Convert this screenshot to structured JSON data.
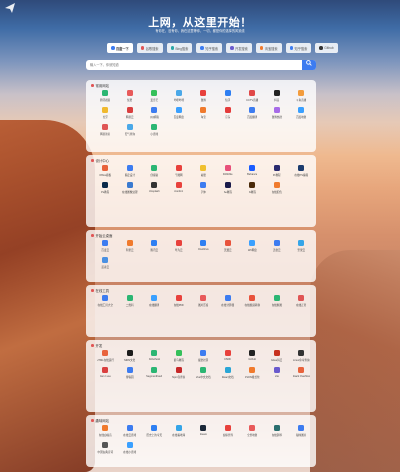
{
  "header": {
    "logo_icon": "paper-plane-icon",
    "title": "上网，从这里开始！",
    "subtitle": "有你在，没有你，我在这里等你，一切，都是你的选择的风景线"
  },
  "search": {
    "engines": [
      {
        "label": "百度一下",
        "color": "#3d7cf0"
      },
      {
        "label": "谷歌搜索",
        "color": "#e05555"
      },
      {
        "label": "Bing搜索",
        "color": "#2aa6a6"
      },
      {
        "label": "知乎搜索",
        "color": "#3d7cf0"
      },
      {
        "label": "开发搜索",
        "color": "#6a5acd"
      },
      {
        "label": "淘宝搜索",
        "color": "#f07a2d"
      },
      {
        "label": "知乎搜索",
        "color": "#3d7cf0"
      },
      {
        "label": "Github",
        "color": "#333333"
      }
    ],
    "placeholder": "输入一下，你就知道",
    "submit_icon": "search-icon"
  },
  "sections": [
    {
      "title": "常用网站",
      "items": [
        {
          "label": "腾讯视频",
          "color": "#2bb673"
        },
        {
          "label": "优酷",
          "color": "#e85a5a"
        },
        {
          "label": "爱奇艺",
          "color": "#35c05a"
        },
        {
          "label": "哔哩哔哩",
          "color": "#4aa8e8"
        },
        {
          "label": "微博",
          "color": "#e8413c"
        },
        {
          "label": "知乎",
          "color": "#2e7ff2"
        },
        {
          "label": "CCTV直播",
          "color": "#e04848"
        },
        {
          "label": "抖音",
          "color": "#222222"
        },
        {
          "label": "斗鱼直播",
          "color": "#f39c3c"
        },
        {
          "label": "虎牙",
          "color": "#f0b92f"
        },
        {
          "label": "网易云",
          "color": "#d93f3f"
        },
        {
          "label": "QQ邮箱",
          "color": "#3d7cf0"
        },
        {
          "label": "百度网盘",
          "color": "#3aa0ff"
        },
        {
          "label": "淘宝",
          "color": "#f07a2d"
        },
        {
          "label": "京东",
          "color": "#e43c3c"
        },
        {
          "label": "百度翻译",
          "color": "#3d7cf0"
        },
        {
          "label": "微博热搜",
          "color": "#a76be8"
        },
        {
          "label": "百度地图",
          "color": "#3aa0ff"
        },
        {
          "label": "网易新闻",
          "color": "#e05555"
        },
        {
          "label": "天气查询",
          "color": "#4aa8e8"
        },
        {
          "label": "小游戏",
          "color": "#2bb673"
        }
      ]
    },
    {
      "title": "设计中心",
      "items": [
        {
          "label": "Office模板",
          "color": "#e8633c"
        },
        {
          "label": "稿定设计",
          "color": "#3d7cf0"
        },
        {
          "label": "创客贴",
          "color": "#2bb673"
        },
        {
          "label": "千图网",
          "color": "#e8413c"
        },
        {
          "label": "站酷",
          "color": "#f0c02f"
        },
        {
          "label": "Dribbble",
          "color": "#e8507a"
        },
        {
          "label": "Behance",
          "color": "#1a5cff"
        },
        {
          "label": "Pr教程",
          "color": "#2a2a6e"
        },
        {
          "label": "在线PS编辑",
          "color": "#1c3c6e"
        },
        {
          "label": "Ps教程",
          "color": "#0a2a4a"
        },
        {
          "label": "在线图像处理",
          "color": "#3a7ad0"
        },
        {
          "label": "Unsplash",
          "color": "#333333"
        },
        {
          "label": "iconfont",
          "color": "#e8413c"
        },
        {
          "label": "字体",
          "color": "#3d7cf0"
        },
        {
          "label": "Ae教程",
          "color": "#1a1a4a"
        },
        {
          "label": "Ai教程",
          "color": "#4a2a0a"
        },
        {
          "label": "在线配色",
          "color": "#f07a2d"
        }
      ]
    },
    {
      "title": "开始云桌面",
      "items": [
        {
          "label": "百度云",
          "color": "#3d7cf0"
        },
        {
          "label": "阿里云",
          "color": "#f07a2d"
        },
        {
          "label": "腾讯云",
          "color": "#2e7ff2"
        },
        {
          "label": "华为云",
          "color": "#e8413c"
        },
        {
          "label": "OneDrive",
          "color": "#2e7ff2"
        },
        {
          "label": "天翼云",
          "color": "#e8533c"
        },
        {
          "label": "115网盘",
          "color": "#3aa0ff"
        },
        {
          "label": "迅雷云",
          "color": "#3d7cf0"
        },
        {
          "label": "坚果云",
          "color": "#35a5e8"
        },
        {
          "label": "蓝奏云",
          "color": "#4a90e2"
        }
      ]
    },
    {
      "title": "在线工具",
      "items": [
        {
          "label": "在线工具大全",
          "color": "#3d7cf0"
        },
        {
          "label": "二维码",
          "color": "#2bb673"
        },
        {
          "label": "在线翻译",
          "color": "#3aa0ff"
        },
        {
          "label": "在线PDF",
          "color": "#e8413c"
        },
        {
          "label": "图片压缩",
          "color": "#e85a5a"
        },
        {
          "label": "在线计算器",
          "color": "#3d7cf0"
        },
        {
          "label": "在线视频转换",
          "color": "#e8533c"
        },
        {
          "label": "在线抠图",
          "color": "#2bb673"
        },
        {
          "label": "在线正则",
          "color": "#e05555"
        }
      ]
    },
    {
      "title": "开发",
      "items": [
        {
          "label": "HTML在线运行",
          "color": "#e8633c"
        },
        {
          "label": "MDN文档",
          "color": "#1c1c1c"
        },
        {
          "label": "W3school",
          "color": "#2bb673"
        },
        {
          "label": "菜鸟教程",
          "color": "#35c05a"
        },
        {
          "label": "掘金社区",
          "color": "#3d7cf0"
        },
        {
          "label": "CSDN",
          "color": "#e8413c"
        },
        {
          "label": "Github",
          "color": "#222222"
        },
        {
          "label": "Gitee码云",
          "color": "#c7311e"
        },
        {
          "label": "Linux命令查询",
          "color": "#333333"
        },
        {
          "label": "Can I use",
          "color": "#d93f3f"
        },
        {
          "label": "博客园",
          "color": "#3d7cf0"
        },
        {
          "label": "SegmentFault",
          "color": "#2bb673"
        },
        {
          "label": "Npm包查询",
          "color": "#c62828"
        },
        {
          "label": "Vue中文文档",
          "color": "#2bb673"
        },
        {
          "label": "React文档",
          "color": "#2aa6d6"
        },
        {
          "label": "JSON格式化",
          "color": "#f07a2d"
        },
        {
          "label": "Vite",
          "color": "#6a5acd"
        },
        {
          "label": "Stack Overflow",
          "color": "#e8633c"
        }
      ]
    },
    {
      "title": "趣味网站",
      "items": [
        {
          "label": "在线白噪音",
          "color": "#f07a2d"
        },
        {
          "label": "在线云游戏",
          "color": "#3d7cf0"
        },
        {
          "label": "历史上的今天",
          "color": "#2e7ff2"
        },
        {
          "label": "在线看地球",
          "color": "#35a5e8"
        },
        {
          "label": "Steam",
          "color": "#1b2838"
        },
        {
          "label": "虚拟世界",
          "color": "#e8413c"
        },
        {
          "label": "全景地图",
          "color": "#e85a5a"
        },
        {
          "label": "在线钢琴",
          "color": "#2a6e6e"
        },
        {
          "label": "猫咪图片",
          "color": "#3d7cf0"
        },
        {
          "label": "中国古典诗词",
          "color": "#555555"
        },
        {
          "label": "在线小游戏",
          "color": "#3aa0ff"
        }
      ]
    }
  ]
}
